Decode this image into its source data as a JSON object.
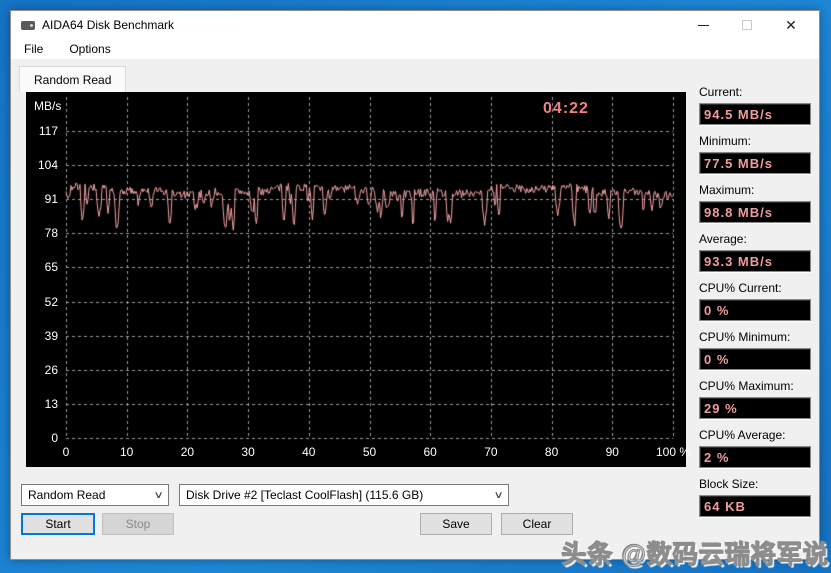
{
  "window": {
    "title": "AIDA64 Disk Benchmark",
    "controls": {
      "minimize": "minimize-icon",
      "maximize": "maximize-icon",
      "close": "close-icon"
    }
  },
  "menu": {
    "items": [
      "File",
      "Options"
    ]
  },
  "tab": {
    "label": "Random Read"
  },
  "chart_data": {
    "type": "line",
    "title": "Random Read throughput over benchmark progress",
    "y_axis_label": "MB/s",
    "elapsed_time": "04:22",
    "y_ticks": [
      117,
      104,
      91,
      78,
      65,
      52,
      39,
      26,
      13,
      0
    ],
    "x_ticks": [
      "0",
      "10",
      "20",
      "30",
      "40",
      "50",
      "60",
      "70",
      "80",
      "90",
      "100 %"
    ],
    "ylim": [
      0,
      130
    ],
    "xlim_percent": [
      0,
      100
    ],
    "grid": true,
    "legend_position": "none",
    "line_color": "#f2a2a4",
    "time_color": "#ef8285",
    "grid_color": "#9b9b9b",
    "background": "#000000",
    "stats": {
      "current": 94.5,
      "minimum": 77.5,
      "maximum": 98.8,
      "average": 93.3,
      "unit": "MB/s"
    },
    "waveform": {
      "base": 94.2,
      "jitter": 1.6,
      "dip_chance": 0.1,
      "dip_min": 3,
      "dip_max": 15,
      "points": 607,
      "seed": 7
    }
  },
  "panel": {
    "items": [
      {
        "label": "Current:",
        "value": "94.5 MB/s"
      },
      {
        "label": "Minimum:",
        "value": "77.5 MB/s"
      },
      {
        "label": "Maximum:",
        "value": "98.8 MB/s"
      },
      {
        "label": "Average:",
        "value": "93.3 MB/s"
      },
      {
        "label": "CPU% Current:",
        "value": "0 %"
      },
      {
        "label": "CPU% Minimum:",
        "value": "0 %"
      },
      {
        "label": "CPU% Maximum:",
        "value": "29 %"
      },
      {
        "label": "CPU% Average:",
        "value": "2 %"
      },
      {
        "label": "Block Size:",
        "value": "64 KB"
      }
    ]
  },
  "controls": {
    "benchmark_select": {
      "value": "Random Read"
    },
    "drive_select": {
      "value": "Disk Drive #2  [Teclast CoolFlash]  (115.6 GB)"
    },
    "start_label": "Start",
    "stop_label": "Stop",
    "save_label": "Save",
    "clear_label": "Clear"
  },
  "watermark": {
    "text": "头条 @数码云瑞将军说"
  }
}
